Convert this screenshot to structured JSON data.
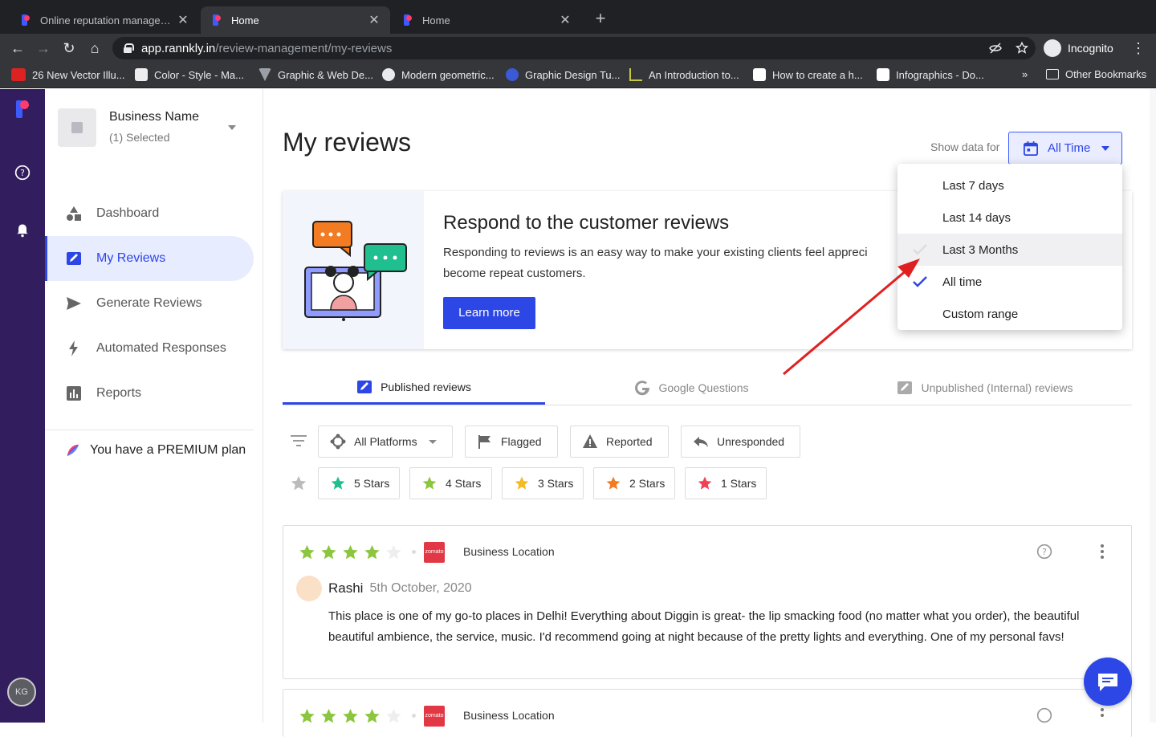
{
  "browser": {
    "tabs": [
      {
        "title": "Online reputation management",
        "active": false
      },
      {
        "title": "Home",
        "active": true
      },
      {
        "title": "Home",
        "active": false
      }
    ],
    "url_host": "app.rannkly.in",
    "url_path": "/review-management/my-reviews",
    "incognito_label": "Incognito",
    "bookmarks": [
      {
        "label": "26 New Vector Illu...",
        "icon": "gdi-icon"
      },
      {
        "label": "Color - Style - Ma...",
        "icon": "doc-icon"
      },
      {
        "label": "Graphic & Web De...",
        "icon": "v-icon"
      },
      {
        "label": "Modern geometric...",
        "icon": "globe-icon"
      },
      {
        "label": "Graphic Design Tu...",
        "icon": "c-icon"
      },
      {
        "label": "An Introduction to...",
        "icon": "l-icon"
      },
      {
        "label": "How to create a h...",
        "icon": "v-logo-icon"
      },
      {
        "label": "Infographics - Do...",
        "icon": "pen-icon"
      }
    ],
    "bookmarks_more": "»",
    "other_bookmarks": "Other Bookmarks"
  },
  "rail": {
    "avatar_initials": "KG"
  },
  "sidebar": {
    "business_name": "Business Name",
    "business_selected": "(1) Selected",
    "items": [
      {
        "label": "Dashboard",
        "icon": "shapes-icon",
        "active": false
      },
      {
        "label": "My Reviews",
        "icon": "review-edit-icon",
        "active": true
      },
      {
        "label": "Generate Reviews",
        "icon": "send-icon",
        "active": false
      },
      {
        "label": "Automated Responses",
        "icon": "bolt-icon",
        "active": false
      },
      {
        "label": "Reports",
        "icon": "bar-chart-icon",
        "active": false
      }
    ],
    "premium_text": "You have a",
    "premium_plan": "PREMIUM plan"
  },
  "main": {
    "title": "My reviews",
    "show_data_for": "Show data for",
    "range_button": "All Time",
    "banner": {
      "heading": "Respond to the customer reviews",
      "text": "Responding to reviews is an easy way to make your existing clients feel appreci",
      "text2": "become repeat customers.",
      "button": "Learn more"
    },
    "dropdown": {
      "options": [
        {
          "label": "Last 7 days",
          "checked": false,
          "hover": false
        },
        {
          "label": "Last 14 days",
          "checked": false,
          "hover": false
        },
        {
          "label": "Last 3 Months",
          "checked": false,
          "hover": true
        },
        {
          "label": "All time",
          "checked": true,
          "hover": false
        },
        {
          "label": "Custom range",
          "checked": false,
          "hover": false
        }
      ]
    },
    "tabs": [
      {
        "label": "Published reviews",
        "active": true
      },
      {
        "label": "Google Questions",
        "active": false
      },
      {
        "label": "Unpublished (Internal) reviews",
        "active": false
      }
    ],
    "filters": {
      "platforms": "All Platforms",
      "flagged": "Flagged",
      "reported": "Reported",
      "unresponded": "Unresponded"
    },
    "star_filters": [
      {
        "label": "5 Stars",
        "color": "#1fbf8f"
      },
      {
        "label": "4 Stars",
        "color": "#8cc63f"
      },
      {
        "label": "3 Stars",
        "color": "#f7b924"
      },
      {
        "label": "2 Stars",
        "color": "#f37b22"
      },
      {
        "label": "1 Stars",
        "color": "#ef4354"
      }
    ],
    "reviews": [
      {
        "rating": 4,
        "platform_logo": "zomato",
        "location": "Business Location",
        "reviewer": "Rashi",
        "date": "5th October, 2020",
        "text": "This place is one of my go-to places in Delhi! Everything about Diggin is great- the lip smacking food (no matter what you order), the beautiful beautiful ambience, the service, music. I'd recommend going at night because of the pretty lights and everything. One of my personal favs!"
      },
      {
        "rating": 4,
        "platform_logo": "zomato",
        "location": "Business Location"
      }
    ]
  },
  "colors": {
    "accent": "#2d46e6",
    "rail": "#321d5e",
    "star_green": "#8cc63f",
    "annotation_arrow": "#e02020"
  }
}
